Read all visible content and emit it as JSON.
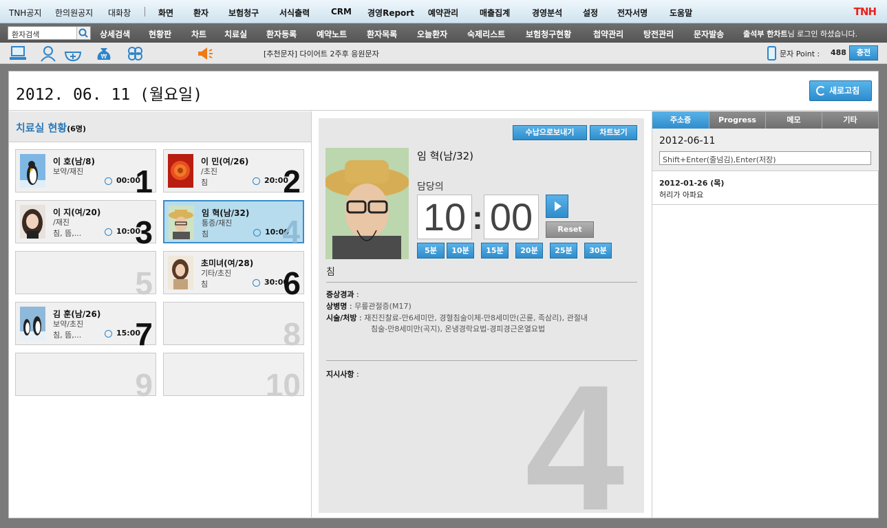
{
  "top_menu": {
    "left_items": [
      "TNH공지",
      "한의원공지",
      "대화창"
    ],
    "main_items": [
      "화면",
      "환자",
      "보험청구",
      "서식출력",
      "CRM",
      "경영Report",
      "예약관리",
      "매출집계",
      "경영분석",
      "설정",
      "전자서명",
      "도움말"
    ],
    "logo": "TNH"
  },
  "sub_menu": {
    "search_placeholder": "환자검색",
    "items": [
      "상세검색",
      "현황판",
      "차트",
      "치료실",
      "환자등록",
      "예약노트",
      "환자목록",
      "오늘환자",
      "숙제리스트",
      "보험청구현황",
      "첩약관리",
      "탕전관리",
      "문자발송"
    ],
    "login_user": "출석부 한차트",
    "login_suffix": "님 로그인 하셨습니다."
  },
  "toolbar": {
    "icons": [
      "computer-icon",
      "doctor-icon",
      "medicine-icon",
      "money-bag-icon",
      "clover-icon",
      "megaphone-icon"
    ],
    "notice": "[추천문자] 다이어트 2주후 응원문자",
    "point_label": "문자 Point :",
    "point_value": "488",
    "charge_label": "충전"
  },
  "header": {
    "date": "2012. 06. 11 (월요일)",
    "refresh_label": "새로고침"
  },
  "treatment_room": {
    "title": "치료실 현황",
    "count": "(6명)",
    "cards": [
      {
        "slot": "1",
        "name": "이   호(남/8)",
        "sub": "보약/재진",
        "sub2": "",
        "time": "00:00",
        "occupied": true,
        "photo": "penguin"
      },
      {
        "slot": "2",
        "name": "이   민(여/26)",
        "sub": "/초진",
        "sub2": "침",
        "time": "20:00",
        "occupied": true,
        "photo": "flower"
      },
      {
        "slot": "3",
        "name": "이   지(여/20)",
        "sub": "/재진",
        "sub2": "침, 뜸,...",
        "time": "10:00",
        "occupied": true,
        "photo": "girl"
      },
      {
        "slot": "4",
        "name": "임   혁(남/32)",
        "sub": "통증/재진",
        "sub2": "침",
        "time": "10:00",
        "occupied": true,
        "selected": true,
        "photo": "man"
      },
      {
        "slot": "5",
        "occupied": false
      },
      {
        "slot": "6",
        "name": "초미녀(여/28)",
        "sub": "기타/초진",
        "sub2": "침",
        "time": "30:00",
        "occupied": true,
        "photo": "woman"
      },
      {
        "slot": "7",
        "name": "김   훈(남/26)",
        "sub": "보약/초진",
        "sub2": "침, 뜸,...",
        "time": "15:00",
        "occupied": true,
        "photo": "penguins"
      },
      {
        "slot": "8",
        "occupied": false
      },
      {
        "slot": "9",
        "occupied": false
      },
      {
        "slot": "10",
        "occupied": false
      }
    ]
  },
  "detail": {
    "send_payment_label": "수납으로보내기",
    "view_chart_label": "차트보기",
    "patient_name": "임   혁(남/32)",
    "doctor_label": "담당의",
    "timer_min": "10",
    "timer_sec": "00",
    "reset_label": "Reset",
    "minute_buttons": [
      "5분",
      "10분",
      "15분",
      "20분",
      "25분",
      "30분"
    ],
    "treatment": "침",
    "symptom_label": "증상경과",
    "diagnosis_label": "상병명",
    "diagnosis_value": "무릎관절증(M17)",
    "procedure_label": "시술/처방",
    "procedure_line1": "재진진찰료-만6세미만, 경혈침술이체-만8세미만(곤륜, 족삼리), 관절내",
    "procedure_line2": "침술-만8세미만(곡지), 온냉경락요법-경피경근온열요법",
    "instruction_label": "지시사항",
    "slot_number": "4"
  },
  "right_panel": {
    "tabs": [
      "주소증",
      "Progress",
      "메모",
      "기타"
    ],
    "active_tab": 0,
    "date": "2012-06-11",
    "input_placeholder": "Shift+Enter(줄넘김),Enter(저장)",
    "notes": [
      {
        "date": "2012-01-26 (목)",
        "text": "허리가 아파요"
      }
    ]
  },
  "colors": {
    "accent": "#2f8dcc",
    "logo": "#e8231d",
    "selected_card": "#b7dcee"
  }
}
